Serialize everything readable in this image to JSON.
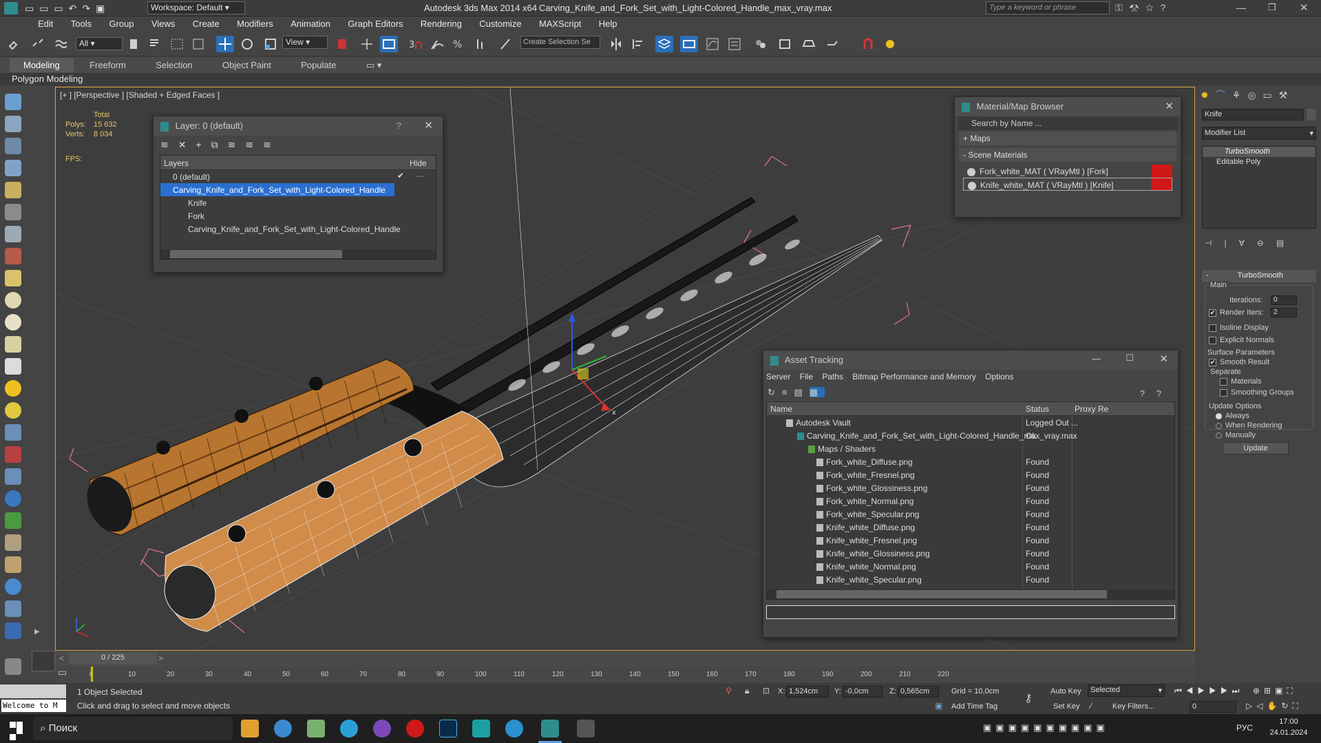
{
  "titlebar": {
    "workspace": "Workspace: Default",
    "app_title": "Autodesk 3ds Max  2014 x64",
    "file_title": "Carving_Knife_and_Fork_Set_with_Light-Colored_Handle_max_vray.max",
    "search_placeholder": "Type a keyword or phrase"
  },
  "menu": [
    "Edit",
    "Tools",
    "Group",
    "Views",
    "Create",
    "Modifiers",
    "Animation",
    "Graph Editors",
    "Rendering",
    "Customize",
    "MAXScript",
    "Help"
  ],
  "toolbar": {
    "filter": "All",
    "refcoord": "View",
    "selection_set": "Create Selection Se"
  },
  "ribbon": {
    "tabs": [
      "Modeling",
      "Freeform",
      "Selection",
      "Object Paint",
      "Populate"
    ],
    "sub": "Polygon Modeling"
  },
  "viewport": {
    "label": "[+ ] [Perspective ] [Shaded + Edged Faces ]",
    "stats_header": "Total",
    "polys_label": "Polys:",
    "polys": "15 632",
    "verts_label": "Verts:",
    "verts": "8 034",
    "fps_label": "FPS:"
  },
  "layer_dialog": {
    "title": "Layer: 0 (default)",
    "help": "?",
    "col_layers": "Layers",
    "col_hide": "Hide",
    "rows": [
      "0 (default)",
      "Carving_Knife_and_Fork_Set_with_Light-Colored_Handle",
      "Knife",
      "Fork",
      "Carving_Knife_and_Fork_Set_with_Light-Colored_Handle"
    ]
  },
  "material_browser": {
    "title": "Material/Map Browser",
    "search_placeholder": "Search by Name ...",
    "maps": "+ Maps",
    "scene_materials": "- Scene Materials",
    "items": [
      "Fork_white_MAT ( VRayMtl ) [Fork]",
      "Knife_white_MAT ( VRayMtl ) [Knife]"
    ]
  },
  "asset_tracking": {
    "title": "Asset Tracking",
    "menu": [
      "Server",
      "File",
      "Paths",
      "Bitmap Performance and Memory",
      "Options"
    ],
    "cols": [
      "Name",
      "Status",
      "Proxy Re"
    ],
    "rows": [
      {
        "name": "Autodesk Vault",
        "status": "Logged Out ..."
      },
      {
        "name": "Carving_Knife_and_Fork_Set_with_Light-Colored_Handle_max_vray.max",
        "status": "Ok"
      },
      {
        "name": "Maps / Shaders",
        "status": ""
      },
      {
        "name": "Fork_white_Diffuse.png",
        "status": "Found"
      },
      {
        "name": "Fork_white_Fresnel.png",
        "status": "Found"
      },
      {
        "name": "Fork_white_Glossiness.png",
        "status": "Found"
      },
      {
        "name": "Fork_white_Normal.png",
        "status": "Found"
      },
      {
        "name": "Fork_white_Specular.png",
        "status": "Found"
      },
      {
        "name": "Knife_white_Diffuse.png",
        "status": "Found"
      },
      {
        "name": "Knife_white_Fresnel.png",
        "status": "Found"
      },
      {
        "name": "Knife_white_Glossiness.png",
        "status": "Found"
      },
      {
        "name": "Knife_white_Normal.png",
        "status": "Found"
      },
      {
        "name": "Knife_white_Specular.png",
        "status": "Found"
      }
    ]
  },
  "command_panel": {
    "object_name": "Knife",
    "modifier_list": "Modifier List",
    "stack": [
      "TurboSmooth",
      "Editable Poly"
    ],
    "rollout": "TurboSmooth",
    "main": "Main",
    "iterations_label": "Iterations:",
    "iterations": "0",
    "render_iters_label": "Render Iters:",
    "render_iters": "2",
    "isoline": "Isoline Display",
    "explicit_normals": "Explicit Normals",
    "surface_params": "Surface Parameters",
    "smooth_result": "Smooth Result",
    "separate": "Separate",
    "materials": "Materials",
    "smoothing_groups": "Smoothing Groups",
    "update_options": "Update Options",
    "always": "Always",
    "when_rendering": "When Rendering",
    "manually": "Manually",
    "update_btn": "Update"
  },
  "timeline": {
    "frame": "0 / 225",
    "ticks": [
      "0",
      "10",
      "20",
      "30",
      "40",
      "50",
      "60",
      "70",
      "80",
      "90",
      "100",
      "110",
      "120",
      "130",
      "140",
      "150",
      "160",
      "170",
      "180",
      "190",
      "200",
      "210",
      "220"
    ]
  },
  "status": {
    "selected": "1 Object Selected",
    "prompt": "Click and drag to select and move objects",
    "welcome": "Welcome to M",
    "x_label": "X:",
    "x": "1,524cm",
    "y_label": "Y:",
    "y": "-0,0cm",
    "z_label": "Z:",
    "z": "0,565cm",
    "grid": "Grid = 10,0cm",
    "add_time_tag": "Add Time Tag",
    "auto_key": "Auto Key",
    "set_key": "Set Key",
    "key_mode": "Selected",
    "key_filters": "Key Filters...",
    "frame_field": "0"
  },
  "taskbar": {
    "search": "Поиск",
    "lang": "РУС",
    "time": "17:00",
    "date": "24.01.2024"
  }
}
